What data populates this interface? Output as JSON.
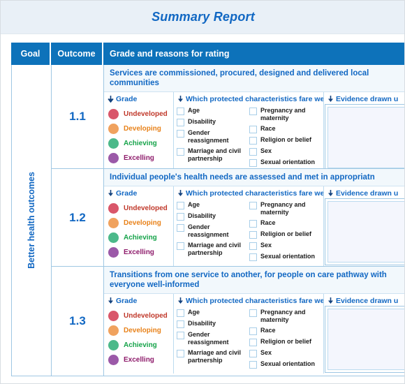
{
  "header": {
    "title": "Summary Report"
  },
  "colors": {
    "brand_blue": "#0d72ba",
    "title_blue": "#1268c3",
    "band_bg": "#e9f0f7",
    "grid_line": "#9fc7e3"
  },
  "table": {
    "columns": [
      {
        "key": "goal",
        "label": "Goal"
      },
      {
        "key": "outcome",
        "label": "Outcome"
      },
      {
        "key": "grade",
        "label": "Grade and reasons for rating"
      }
    ],
    "goal_label": "Better health outcomes",
    "panel_headings": {
      "grade": "Grade",
      "characteristics": "Which protected characteristics fare well",
      "evidence": "Evidence drawn u"
    },
    "grades": [
      {
        "label": "Undeveloped",
        "color": "#d9566a",
        "text_color": "#c0392b"
      },
      {
        "label": "Developing",
        "color": "#f0a25e",
        "text_color": "#e8821a"
      },
      {
        "label": "Achieving",
        "color": "#4cb98a",
        "text_color": "#16a34a"
      },
      {
        "label": "Excelling",
        "color": "#9b59a8",
        "text_color": "#8e1b6b"
      }
    ],
    "characteristics_left": [
      "Age",
      "Disability",
      "Gender reassignment",
      "Marriage and civil partnership"
    ],
    "characteristics_right": [
      "Pregnancy and maternity",
      "Race",
      "Religion or belief",
      "Sex",
      "Sexual orientation"
    ],
    "rows": [
      {
        "outcome": "1.1",
        "title": "Services are commissioned, procured, designed and delivered local communities",
        "title_lines": 2
      },
      {
        "outcome": "1.2",
        "title": "Individual people's health needs are assessed and met in appropriatn",
        "title_lines": 1
      },
      {
        "outcome": "1.3",
        "title": "Transitions from one service to another, for people on care pathway with everyone well-informed",
        "title_lines": 2
      }
    ]
  }
}
